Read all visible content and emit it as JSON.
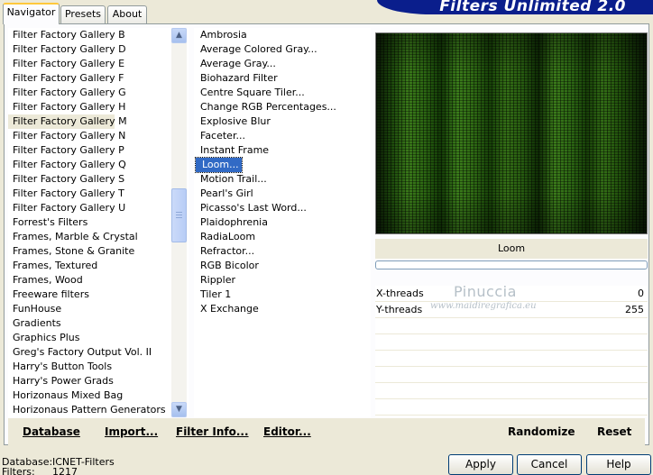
{
  "tabs": [
    {
      "label": "Navigator",
      "active": true
    },
    {
      "label": "Presets",
      "active": false
    },
    {
      "label": "About",
      "active": false
    }
  ],
  "brand": "Filters Unlimited 2.0",
  "categories": [
    "Filter Factory Gallery B",
    "Filter Factory Gallery D",
    "Filter Factory Gallery E",
    "Filter Factory Gallery F",
    "Filter Factory Gallery G",
    "Filter Factory Gallery H",
    "Filter Factory Gallery M",
    "Filter Factory Gallery N",
    "Filter Factory Gallery P",
    "Filter Factory Gallery Q",
    "Filter Factory Gallery S",
    "Filter Factory Gallery T",
    "Filter Factory Gallery U",
    "Forrest's Filters",
    "Frames, Marble & Crystal",
    "Frames, Stone & Granite",
    "Frames, Textured",
    "Frames, Wood",
    "Freeware filters",
    "FunHouse",
    "Gradients",
    "Graphics Plus",
    "Greg's Factory Output Vol. II",
    "Harry's Button Tools",
    "Harry's Power Grads",
    "Horizonaus Mixed Bag",
    "Horizonaus Pattern Generators"
  ],
  "selected_category": "Filter Factory Gallery M",
  "filters": [
    "Ambrosia",
    "Average Colored Gray...",
    "Average Gray...",
    "Biohazard Filter",
    "Centre Square Tiler...",
    "Change RGB Percentages...",
    "Explosive Blur",
    "Faceter...",
    "Instant Frame",
    "Loom...",
    "Motion Trail...",
    "Pearl's Girl",
    "Picasso's Last Word...",
    "Plaidophrenia",
    "RadiaLoom",
    "Refractor...",
    "RGB Bicolor",
    "Rippler",
    "Tiler 1",
    "X Exchange"
  ],
  "selected_filter": "Loom...",
  "current_filter_name": "Loom",
  "parameters": [
    {
      "label": "X-threads",
      "value": "0"
    },
    {
      "label": "Y-threads",
      "value": "255"
    }
  ],
  "watermark": {
    "line1": "Pinuccia",
    "line2": "www.maidiregrafica.eu"
  },
  "actions": {
    "database": "Database",
    "import": "Import...",
    "filter_info": "Filter Info...",
    "editor": "Editor...",
    "randomize": "Randomize",
    "reset": "Reset"
  },
  "footer": {
    "database_label": "Database:",
    "database_value": "ICNET-Filters",
    "filters_label": "Filters:",
    "filters_value": "1217"
  },
  "buttons": {
    "apply": "Apply",
    "cancel": "Cancel",
    "help": "Help"
  },
  "icons": {
    "scroll_up": "arrow-up-icon",
    "scroll_down": "arrow-down-icon"
  },
  "colors": {
    "selection_blue": "#316ac5",
    "brand_banner": "#0a1e8c",
    "window_bg": "#ece9d8"
  }
}
